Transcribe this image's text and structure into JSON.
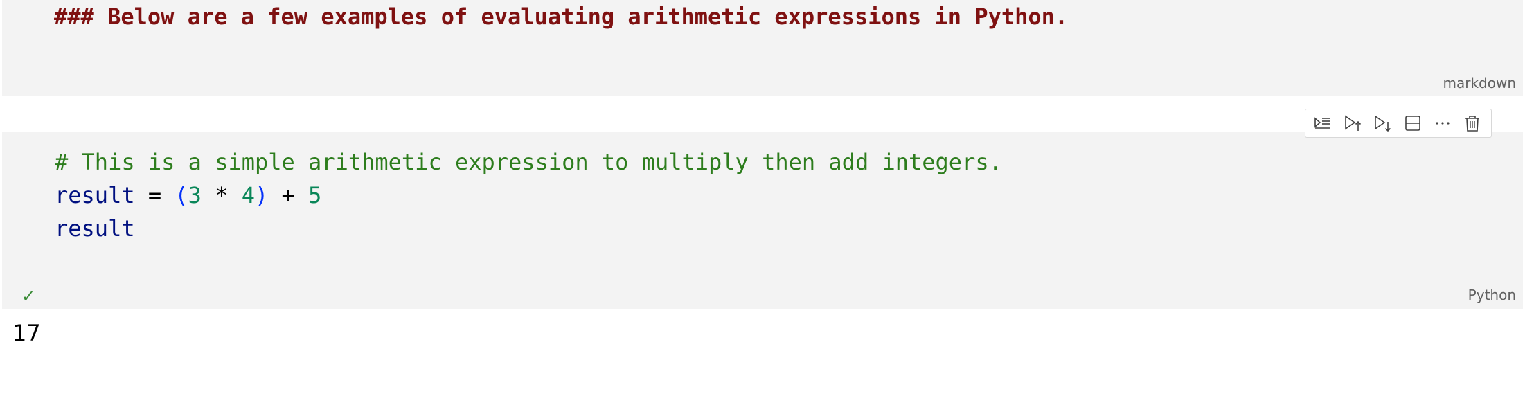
{
  "markdown_cell": {
    "source": "### Below are a few examples of evaluating arithmetic expressions in Python.",
    "language": "markdown"
  },
  "toolbar": {
    "buttons": [
      {
        "icon": "run-by-line-icon"
      },
      {
        "icon": "execute-above-icon"
      },
      {
        "icon": "execute-below-icon"
      },
      {
        "icon": "split-cell-icon"
      },
      {
        "icon": "more-actions-icon"
      },
      {
        "icon": "delete-cell-icon"
      }
    ]
  },
  "code_cell": {
    "comment": "# This is a simple arithmetic expression to multiply then add integers.",
    "line2": {
      "var": "result",
      "eq": " = ",
      "lparen": "(",
      "n1": "3",
      "mul": " * ",
      "n2": "4",
      "rparen": ")",
      "plus": " + ",
      "n3": "5"
    },
    "line3": "result",
    "status": "✓",
    "language": "Python"
  },
  "output": {
    "value": "17"
  }
}
